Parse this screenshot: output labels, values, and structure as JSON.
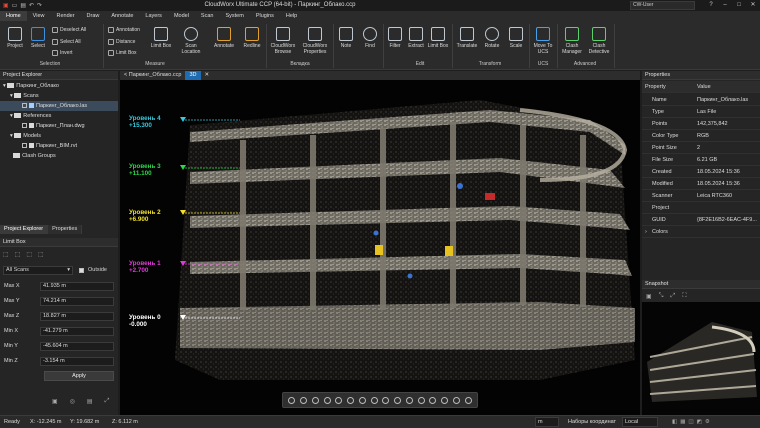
{
  "titlebar": {
    "title": "CloudWorx Ultimate CCP (64-bit) - Паркинг_Облако.ccp",
    "user": "CW-User"
  },
  "menu": [
    "Home",
    "View",
    "Render",
    "Draw",
    "Annotate",
    "Layers",
    "Model",
    "Scan",
    "System",
    "Plugins",
    "Help"
  ],
  "ribbon": {
    "project": "Project",
    "select": "Select",
    "deselect_all": "Deselect All",
    "select_all": "Select All",
    "invert": "Invert",
    "annotation": "Annotation",
    "distance": "Distance",
    "limit_box_small": "Limit Box",
    "limit_box": "Limit Box",
    "scan_location": "Scan Location",
    "annotate": "Annotate",
    "redline": "Redline",
    "cw_browse": "CloudWorx Browse",
    "cw_properties": "CloudWorx Properties",
    "note": "Note",
    "find": "Find",
    "filter": "Filter",
    "extract": "Extract",
    "limit_box2": "Limit Box",
    "translate": "Translate",
    "rotate": "Rotate",
    "scale": "Scale",
    "move_ucs": "Move To UCS",
    "clash_manager": "Clash Manager",
    "clash_detective": "Clash Detective",
    "groups": [
      "Selection",
      "Measure",
      "Вкладка",
      "Edit",
      "Transform",
      "UCS",
      "Advanced"
    ]
  },
  "project_explorer": {
    "title": "Project Explorer",
    "tree": [
      {
        "label": "Паркинг_Облако",
        "indent": 0
      },
      {
        "label": "Scans",
        "indent": 1
      },
      {
        "label": "Паркинг_Облако.las",
        "indent": 2,
        "selected": true
      },
      {
        "label": "References",
        "indent": 1
      },
      {
        "label": "Паркинг_План.dwg",
        "indent": 2
      },
      {
        "label": "Models",
        "indent": 1
      },
      {
        "label": "Паркинг_BIM.rvt",
        "indent": 2
      },
      {
        "label": "Clash Groups",
        "indent": 1
      }
    ],
    "tabs": [
      "Project Explorer",
      "Properties"
    ]
  },
  "limit_box": {
    "title": "Limit Box",
    "scope": "All Scans",
    "outside": "Outside",
    "rows": [
      [
        "Max X",
        "41.935 m"
      ],
      [
        "Max Y",
        "74.214 m"
      ],
      [
        "Max Z",
        "18.827 m"
      ],
      [
        "Min X",
        "-41.279 m"
      ],
      [
        "Min Y",
        "-45.604 m"
      ],
      [
        "Min Z",
        "-3.154 m"
      ]
    ],
    "apply": "Apply"
  },
  "viewport": {
    "tabs": [
      "< Паркинг_Облако.ccp",
      "3D"
    ],
    "levels": [
      {
        "name": "Уровень 4",
        "elev": "+15.300",
        "color": "#37c9dc"
      },
      {
        "name": "Уровень 3",
        "elev": "+11.100",
        "color": "#2bd94a"
      },
      {
        "name": "Уровень 2",
        "elev": "+6.900",
        "color": "#f2e02a"
      },
      {
        "name": "Уровень 1",
        "elev": "+2.700",
        "color": "#e23ad8"
      },
      {
        "name": "Уровень 0",
        "elev": "-0.000",
        "color": "#ffffff"
      }
    ]
  },
  "properties": {
    "title": "Properties",
    "col_property": "Property",
    "col_value": "Value",
    "rows": [
      [
        "Name",
        "Паркинг_Облако.las"
      ],
      [
        "Type",
        "Las File"
      ],
      [
        "Points",
        "142,375,842"
      ],
      [
        "Color Type",
        "RGB"
      ],
      [
        "Point Size",
        "2"
      ],
      [
        "File Size",
        "6.21 GB"
      ],
      [
        "Created",
        "18.05.2024 15:36"
      ],
      [
        "Modified",
        "18.05.2024 15:36"
      ],
      [
        "Scanner",
        "Leica RTC360"
      ],
      [
        "Project",
        ""
      ],
      [
        "GUID",
        "{8F2E16B2-6EAC-4F9..."
      ]
    ],
    "colors": "Colors"
  },
  "snapshot": {
    "title": "Snapshot"
  },
  "status": {
    "ready": "Ready",
    "x": "X: -12.245 m",
    "y": "Y: 19.682 m",
    "z": "Z: 6.112 m",
    "units": "m",
    "coord_label": "Наборы координат",
    "coord_value": "Local"
  },
  "colors": {
    "accent": "#1f6cb0",
    "bg": "#1e1e1e",
    "panel": "#252526"
  }
}
